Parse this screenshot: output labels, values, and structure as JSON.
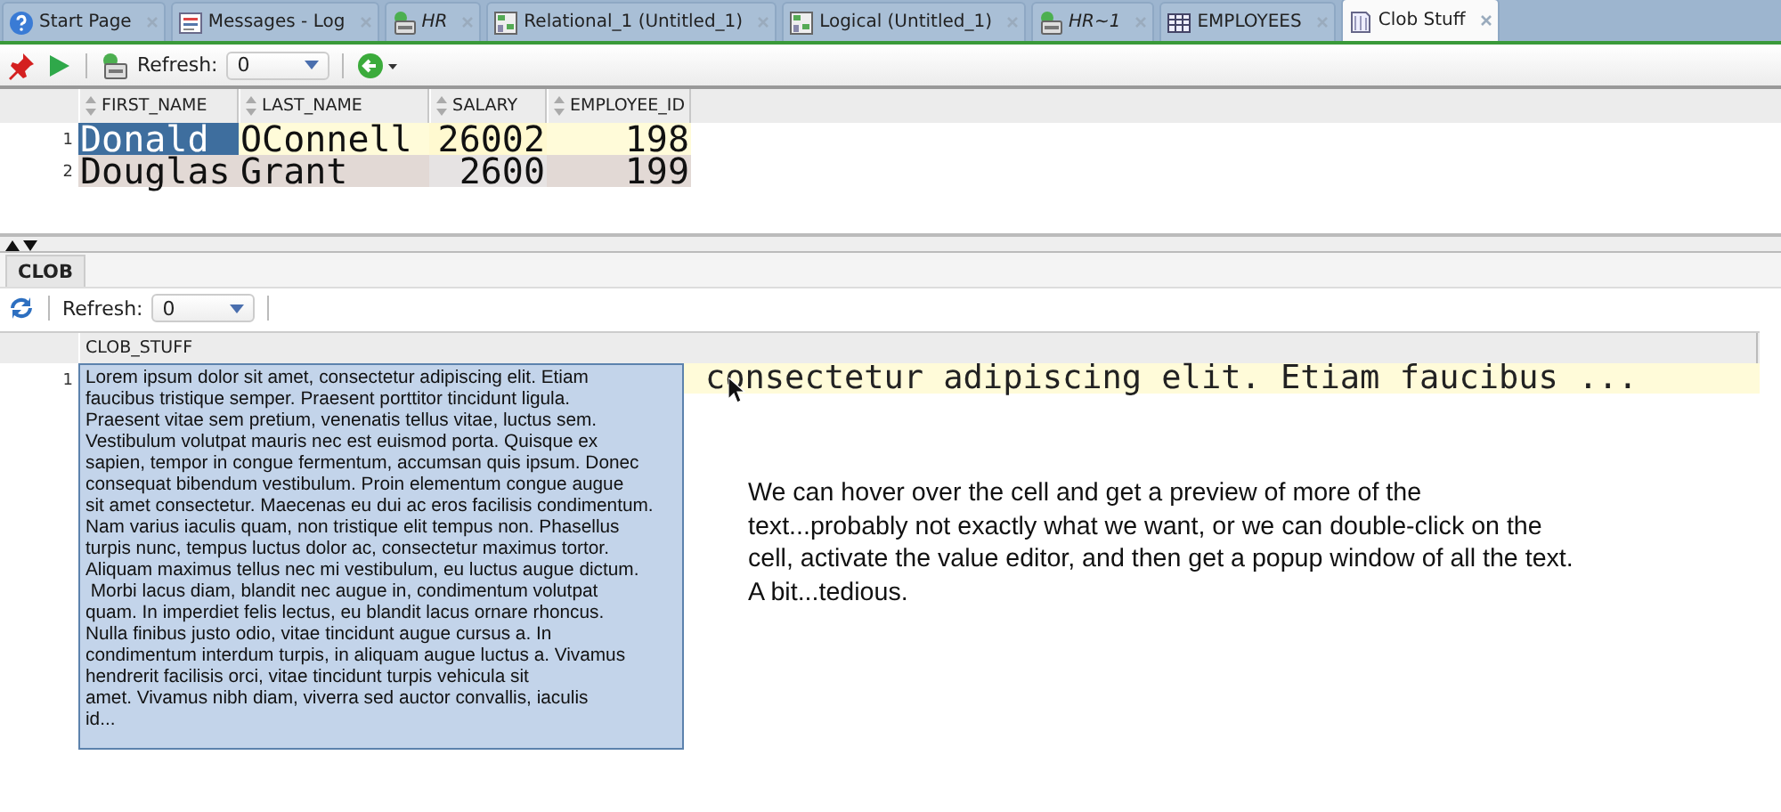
{
  "tabs": [
    {
      "label": "Start Page",
      "kind": "help",
      "italic": false,
      "selected": false
    },
    {
      "label": "Messages - Log",
      "kind": "log",
      "italic": false,
      "selected": false
    },
    {
      "label": "HR",
      "kind": "sql",
      "italic": true,
      "selected": false
    },
    {
      "label": "Relational_1 (Untitled_1)",
      "kind": "model",
      "italic": false,
      "selected": false
    },
    {
      "label": "Logical (Untitled_1)",
      "kind": "model",
      "italic": false,
      "selected": false
    },
    {
      "label": "HR~1",
      "kind": "sql",
      "italic": true,
      "selected": false
    },
    {
      "label": "EMPLOYEES",
      "kind": "table",
      "italic": false,
      "selected": false
    },
    {
      "label": "Clob Stuff",
      "kind": "doc",
      "italic": false,
      "selected": true
    }
  ],
  "toolbar": {
    "refresh_label": "Refresh:",
    "refresh_value": "0"
  },
  "grid": {
    "columns": [
      "FIRST_NAME",
      "LAST_NAME",
      "SALARY",
      "EMPLOYEE_ID"
    ],
    "rows": [
      {
        "number": "1",
        "cells": [
          {
            "text": "Donald",
            "selected": true
          },
          {
            "text": "OConnell",
            "selected": false
          },
          {
            "text": "26002",
            "selected": false
          },
          {
            "text": "198",
            "selected": false
          }
        ]
      },
      {
        "number": "2",
        "cells": [
          {
            "text": "Douglas",
            "selected": false
          },
          {
            "text": "Grant",
            "selected": false
          },
          {
            "text": "2600",
            "selected": false
          },
          {
            "text": "199",
            "selected": false
          }
        ]
      }
    ]
  },
  "clob_panel": {
    "tab": "CLOB",
    "refresh_label": "Refresh:",
    "refresh_value": "0",
    "column": "CLOB_STUFF",
    "row_number": "1",
    "cell_text": "consectetur adipiscing elit. Etiam faucibus ...",
    "preview": "Lorem ipsum dolor sit amet, consectetur adipiscing elit. Etiam\nfaucibus tristique semper. Praesent porttitor tincidunt ligula.\nPraesent vitae sem pretium, venenatis tellus vitae, luctus sem.\nVestibulum volutpat mauris nec est euismod porta. Quisque ex\nsapien, tempor in congue fermentum, accumsan quis ipsum. Donec\nconsequat bibendum vestibulum. Proin elementum congue augue\nsit amet consectetur. Maecenas eu dui ac eros facilisis condimentum.\nNam varius iaculis quam, non tristique elit tempus non. Phasellus\nturpis nunc, tempus luctus dolor ac, consectetur maximus tortor.\nAliquam maximus tellus nec mi vestibulum, eu luctus augue dictum.\n Morbi lacus diam, blandit nec augue in, condimentum volutpat\nquam. In imperdiet felis lectus, eu blandit lacus ornare rhoncus.\nNulla finibus justo odio, vitae tincidunt augue cursus a. In\ncondimentum interdum turpis, in aliquam augue luctus a. Vivamus\nhendrerit facilisis orci, vitae tincidunt turpis vehicula sit\namet. Vivamus nibh diam, viverra sed auctor convallis, iaculis\nid..."
  },
  "note": "We can hover over the cell and get a preview of more of the\ntext...probably not exactly what we want, or we can double-click on the\ncell, activate the value editor, and then get a popup window of all the text.\nA bit...tedious."
}
